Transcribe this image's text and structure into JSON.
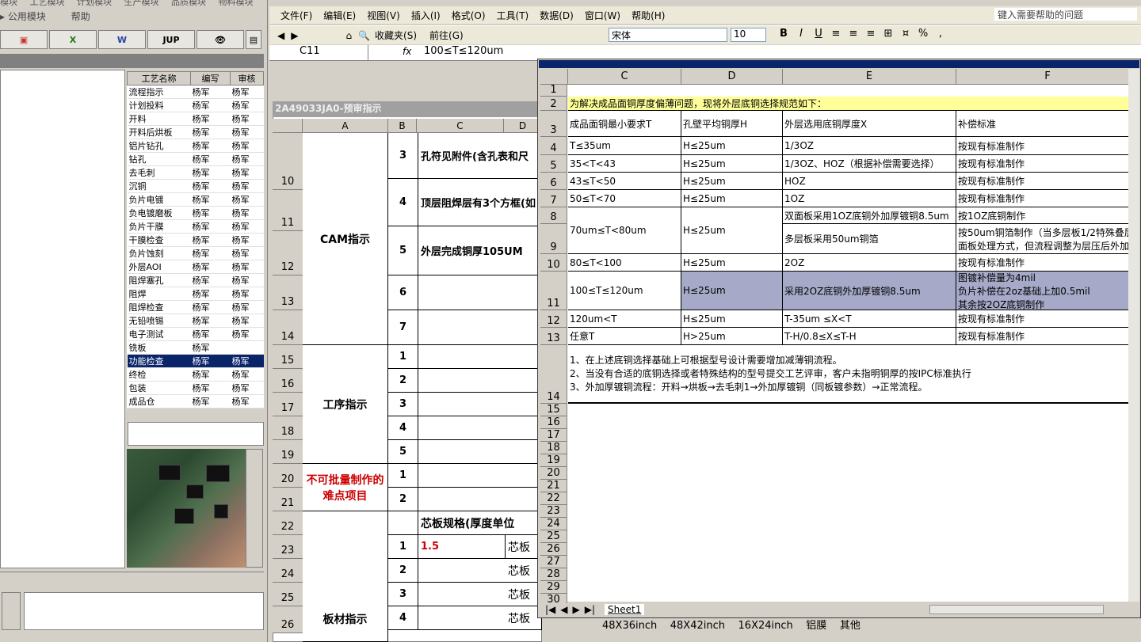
{
  "left": {
    "menu_top": [
      "模块",
      "工艺模块",
      "计划模块",
      "生产模块",
      "品质模块",
      "物料模块"
    ],
    "menu": [
      "公用模块",
      "帮助"
    ],
    "toolbar": [
      "",
      "X",
      "W",
      "JUP",
      "👁",
      ""
    ],
    "table_headers": [
      "工艺名称",
      "编写",
      "审核"
    ],
    "rows": [
      [
        "流程指示",
        "杨军",
        "杨军"
      ],
      [
        "计划投料",
        "杨军",
        "杨军"
      ],
      [
        "开料",
        "杨军",
        "杨军"
      ],
      [
        "开料后烘板",
        "杨军",
        "杨军"
      ],
      [
        "铝片钻孔",
        "杨军",
        "杨军"
      ],
      [
        "钻孔",
        "杨军",
        "杨军"
      ],
      [
        "去毛刺",
        "杨军",
        "杨军"
      ],
      [
        "沉铜",
        "杨军",
        "杨军"
      ],
      [
        "负片电镀",
        "杨军",
        "杨军"
      ],
      [
        "负电镀磨板",
        "杨军",
        "杨军"
      ],
      [
        "负片干膜",
        "杨军",
        "杨军"
      ],
      [
        "干膜检查",
        "杨军",
        "杨军"
      ],
      [
        "负片蚀刻",
        "杨军",
        "杨军"
      ],
      [
        "外层AOI",
        "杨军",
        "杨军"
      ],
      [
        "阻焊塞孔",
        "杨军",
        "杨军"
      ],
      [
        "阻焊",
        "杨军",
        "杨军"
      ],
      [
        "阻焊检查",
        "杨军",
        "杨军"
      ],
      [
        "无铅喷锡",
        "杨军",
        "杨军"
      ],
      [
        "电子测试",
        "杨军",
        "杨军"
      ],
      [
        "铣板",
        "杨军",
        ""
      ],
      [
        "功能检查",
        "杨军",
        "杨军"
      ],
      [
        "终检",
        "杨军",
        "杨军"
      ],
      [
        "包装",
        "杨军",
        "杨军"
      ],
      [
        "成品仓",
        "杨军",
        "杨军"
      ]
    ],
    "selected_row": 20
  },
  "excel": {
    "menu": [
      "文件(F)",
      "编辑(E)",
      "视图(V)",
      "插入(I)",
      "格式(O)",
      "工具(T)",
      "数据(D)",
      "窗口(W)",
      "帮助(H)"
    ],
    "help_placeholder": "键入需要帮助的问题",
    "toolbar": [
      "收藏夹(S)",
      "前往(G)"
    ],
    "font": "宋体",
    "size": "10",
    "fmt": [
      "B",
      "I",
      "U",
      "%",
      ","
    ],
    "namebox": "C11",
    "fx": "fx",
    "formula": "100≤T≤120um"
  },
  "back": {
    "title": "2A49033JA0-预审指示",
    "cols": [
      "A",
      "B",
      "C",
      "D"
    ],
    "rows": [
      "10",
      "11",
      "12",
      "13",
      "14",
      "15",
      "16",
      "17",
      "18",
      "19",
      "20",
      "21",
      "22",
      "23",
      "24",
      "25",
      "26"
    ],
    "cam": "CAM指示",
    "proc": "工序指示",
    "hard": "不可批量制作的难点项目",
    "board": "板材指示",
    "items": [
      "孔符见附件(含孔表和尺",
      "顶层阻焊层有3个方框(如",
      "外层完成铜厚105UM"
    ],
    "nums": [
      "3",
      "4",
      "5",
      "6",
      "7",
      "1",
      "2",
      "3",
      "4",
      "5",
      "1",
      "2",
      "1",
      "2",
      "3",
      "4"
    ],
    "core": "芯板规格(厚度单位",
    "val15": "1.5",
    "cb": "芯板"
  },
  "front": {
    "cols": [
      "C",
      "D",
      "E",
      "F"
    ],
    "rownums": [
      "1",
      "2",
      "3",
      "4",
      "5",
      "6",
      "7",
      "8",
      "9",
      "10",
      "11",
      "12",
      "13",
      "14",
      "15",
      "16",
      "17",
      "18",
      "19",
      "20",
      "21",
      "22",
      "23",
      "24",
      "25",
      "26",
      "27",
      "28",
      "29",
      "30"
    ],
    "title": "为解决成品面铜厚度偏薄问题，现将外层底铜选择规范如下：",
    "headers": [
      "成品面铜最小要求T",
      "孔壁平均铜厚H",
      "外层选用底铜厚度X",
      "补偿标准"
    ],
    "r4": [
      "T≤35um",
      "H≤25um",
      "1/3OZ",
      "按现有标准制作"
    ],
    "r5": [
      "35<T<43",
      "H≤25um",
      "1/3OZ、HOZ（根据补偿需要选择）",
      "按现有标准制作"
    ],
    "r6": [
      "43≤T<50",
      "H≤25um",
      "HOZ",
      "按现有标准制作"
    ],
    "r7": [
      "50≤T<70",
      "H≤25um",
      "1OZ",
      "按现有标准制作"
    ],
    "r89": [
      "70um≤T<80um",
      "H≤25um",
      "双面板采用1OZ底铜外加厚镀铜8.5um",
      "按1OZ底铜制作",
      "多层板采用50um铜箔",
      "按50um铜箔制作（当多层板1/2特殊叠层",
      "面板处理方式，但流程调整为层压后外加"
    ],
    "r10": [
      "80≤T<100",
      "H≤25um",
      "2OZ",
      "按现有标准制作"
    ],
    "r11": [
      "100≤T≤120um",
      "H≤25um",
      "采用2OZ底铜外加厚镀铜8.5um",
      "图镀补偿量为4mil",
      "负片补偿在2oz基础上加0.5mil",
      "其余按2OZ底铜制作"
    ],
    "r12": [
      "120um<T",
      "H≤25um",
      "T-35um ≤X<T",
      "按现有标准制作"
    ],
    "r13": [
      "任意T",
      "H>25um",
      "T-H/0.8≤X≤T-H",
      "按现有标准制作"
    ],
    "notes": [
      "1、在上述底铜选择基础上可根据型号设计需要增加减薄铜流程。",
      "2、当没有合适的底铜选择或者特殊结构的型号提交工艺评审，客户未指明铜厚的按IPC标准执行",
      "3、外加厚镀铜流程：开料→烘板→去毛刺1→外加厚镀铜（同板镀参数）→正常流程。"
    ],
    "tab": "Sheet1",
    "bottom": [
      "48X36inch",
      "48X42inch",
      "16X24inch",
      "铝膜",
      "其他"
    ]
  },
  "colors": {
    "selected": "#0a246a",
    "yellow": "#ffff99",
    "highlight": "#a6aac8"
  }
}
